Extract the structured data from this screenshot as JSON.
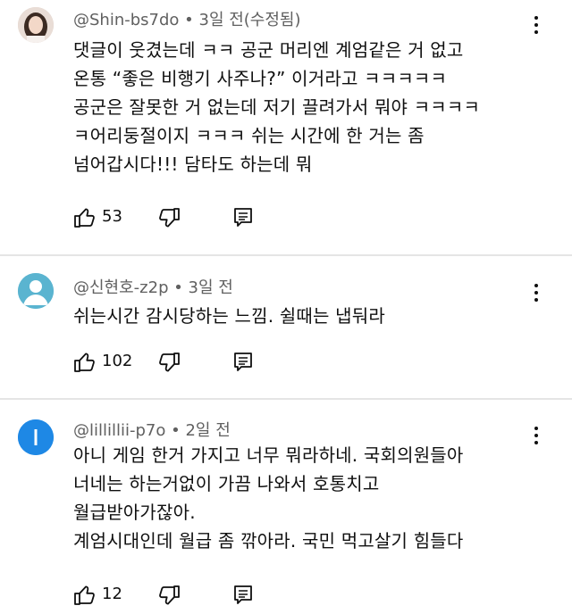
{
  "colors": {
    "divider": "#e5e5e5",
    "meta_text": "#606060",
    "avatar2_bg": "#5ab4d0",
    "avatar3_bg": "#1e88e5"
  },
  "comments": [
    {
      "meta": "@Shin-bs7do • 3일 전(수정됨)",
      "text": "댓글이 웃겼는데 ㅋㅋ 공군 머리엔 계엄같은 거 없고\n온통 “좋은 비행기 사주나?” 이거라고 ㅋㅋㅋㅋㅋ\n공군은 잘못한 거 없는데 저기 끌려가서 뭐야 ㅋㅋㅋㅋ\nㅋ어리둥절이지 ㅋㅋㅋ 쉬는 시간에 한 거는 좀\n넘어갑시다!!! 담타도 하는데 뭐",
      "likes": "53",
      "avatar_icon": "user-photo-icon"
    },
    {
      "meta": "@신현호-z2p • 3일 전",
      "text": "쉬는시간 감시당하는 느낌. 쉴때는 냅둬라",
      "likes": "102",
      "avatar_icon": "default-user-icon"
    },
    {
      "meta": "@lillillii-p7o • 2일 전",
      "text": "아니 게임 한거 가지고 너무 뭐라하네. 국회의원들아\n너네는 하는거없이 가끔 나와서 호통치고\n월급받아가잖아.\n계엄시대인데 월급 좀 깎아라. 국민 먹고살기 힘들다",
      "likes": "12",
      "avatar_letter": "l"
    }
  ]
}
